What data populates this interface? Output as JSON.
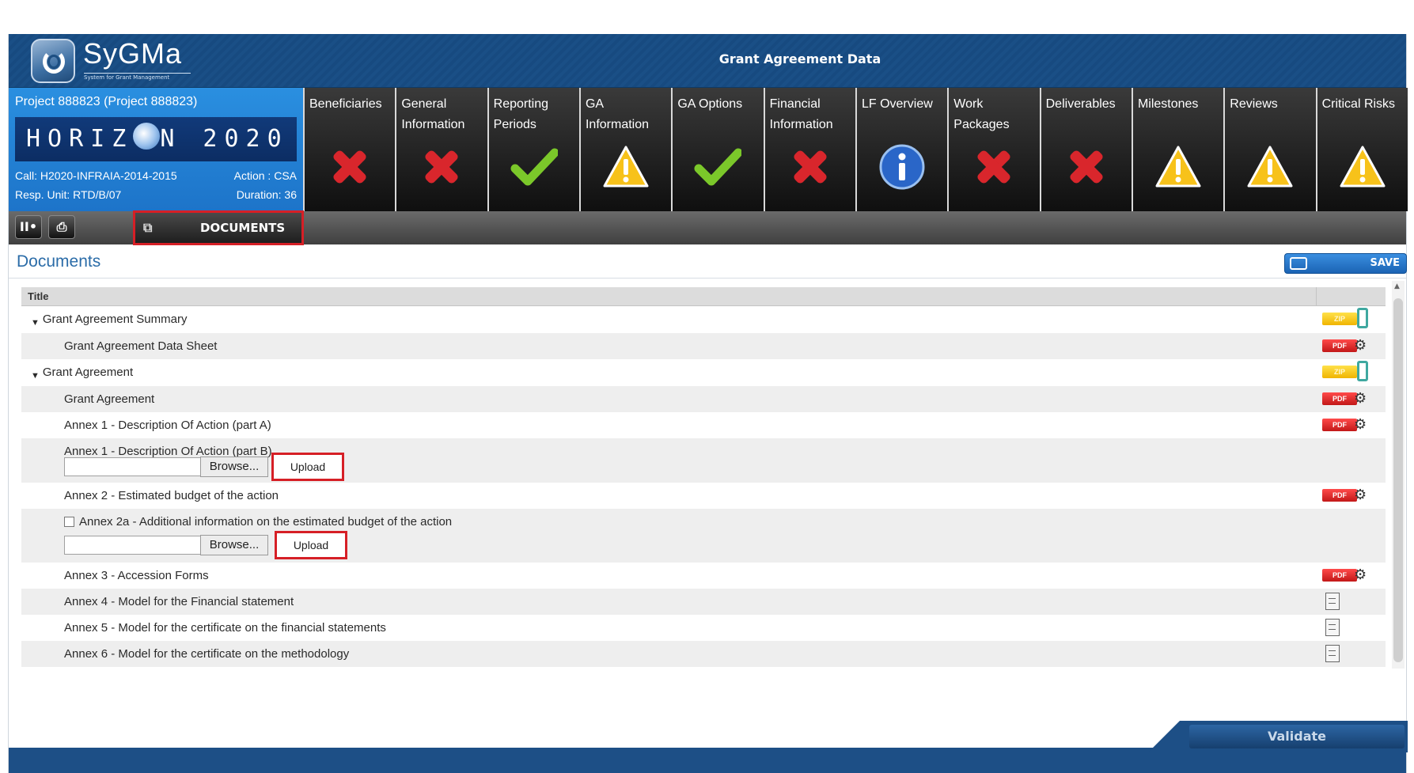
{
  "header": {
    "logo_text": "SyGMa",
    "logo_sub": "System for Grant Management",
    "title": "Grant Agreement Data"
  },
  "project": {
    "title": "Project 888823 (Project 888823)",
    "banner": "HORIZ 2020",
    "banner_left": "HORIZ",
    "banner_right": "N 2020",
    "call": "Call: H2020-INFRAIA-2014-2015",
    "action": "Action : CSA",
    "resp_unit": "Resp. Unit: RTD/B/07",
    "duration": "Duration: 36"
  },
  "tabs": [
    {
      "label": "Beneficiaries",
      "status": "error",
      "icon": "red-x-icon"
    },
    {
      "label": "General Information",
      "status": "error",
      "icon": "red-x-icon"
    },
    {
      "label": "Reporting Periods",
      "status": "ok",
      "icon": "green-check-icon"
    },
    {
      "label": "GA Information",
      "status": "warning",
      "icon": "warning-icon"
    },
    {
      "label": "GA Options",
      "status": "ok",
      "icon": "green-check-icon"
    },
    {
      "label": "Financial Information",
      "status": "error",
      "icon": "red-x-icon"
    },
    {
      "label": "LF Overview",
      "status": "info",
      "icon": "info-icon"
    },
    {
      "label": "Work Packages",
      "status": "error",
      "icon": "red-x-icon"
    },
    {
      "label": "Deliverables",
      "status": "error",
      "icon": "red-x-icon"
    },
    {
      "label": "Milestones",
      "status": "warning",
      "icon": "warning-icon"
    },
    {
      "label": "Reviews",
      "status": "warning",
      "icon": "warning-icon"
    },
    {
      "label": "Critical Risks",
      "status": "warning",
      "icon": "warning-icon"
    }
  ],
  "toolbar": {
    "btn1": "II•",
    "btn2": "⎙",
    "documents_label": "DOCUMENTS"
  },
  "documents": {
    "title": "Documents",
    "save_label": "SAVE",
    "column_title": "Title",
    "rows": [
      {
        "label": "Grant Agreement Summary",
        "level": 0,
        "expanded": true,
        "file": "zip"
      },
      {
        "label": "Grant Agreement Data Sheet",
        "level": 1,
        "file": "pdf"
      },
      {
        "label": "Grant Agreement",
        "level": 0,
        "expanded": true,
        "file": "zip"
      },
      {
        "label": "Grant Agreement",
        "level": 1,
        "file": "pdf"
      },
      {
        "label": "Annex 1 - Description Of Action (part A)",
        "level": 1,
        "file": "pdf"
      },
      {
        "label": "Annex 1 - Description Of Action (part B)",
        "level": 1,
        "upload": true
      },
      {
        "label": "Annex 2 - Estimated budget of the action",
        "level": 1,
        "file": "pdf"
      },
      {
        "label": "Annex 2a - Additional information on the estimated budget of the action",
        "level": 1,
        "checkbox": true,
        "upload": true
      },
      {
        "label": "Annex 3 - Accession Forms",
        "level": 1,
        "file": "pdf"
      },
      {
        "label": "Annex 4 - Model for the Financial statement",
        "level": 1,
        "file": "form"
      },
      {
        "label": "Annex 5 - Model for the certificate on the financial statements",
        "level": 1,
        "file": "form"
      },
      {
        "label": "Annex 6 - Model for the certificate on the methodology",
        "level": 1,
        "file": "form"
      }
    ],
    "browse_label": "Browse...",
    "upload_label": "Upload",
    "pdf_badge": "PDF",
    "zip_badge": "ZIP"
  },
  "footer": {
    "validate_label": "Validate"
  },
  "colors": {
    "header_blue": "#1a4f86",
    "project_blue": "#1d74c9",
    "error_red": "#d9262c",
    "ok_green": "#7bc82a",
    "warning_yellow": "#f7c21a",
    "info_blue": "#2a66c8",
    "highlight_red": "#d61f26"
  }
}
